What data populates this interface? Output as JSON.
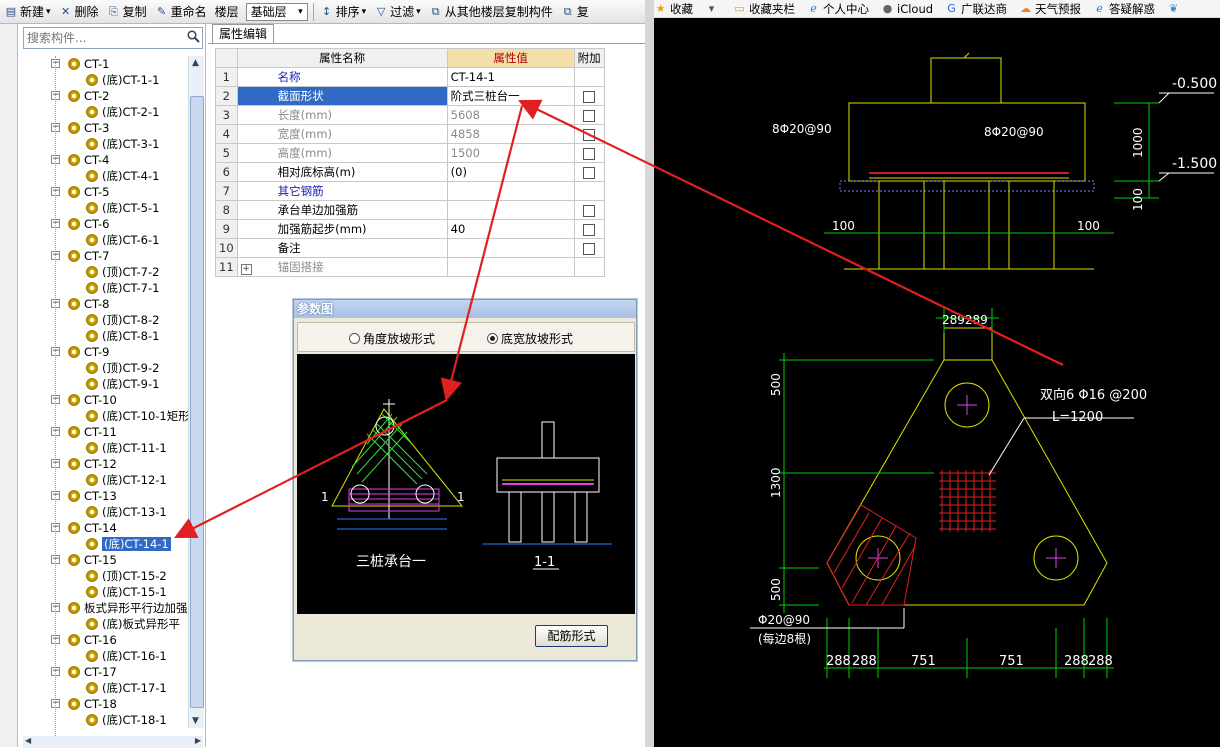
{
  "toolbar": {
    "items": [
      {
        "icon": "new-icon",
        "label": "新建",
        "dropdown": true
      },
      {
        "icon": "delete-icon",
        "label": "删除"
      },
      {
        "icon": "copy-icon",
        "label": "复制"
      },
      {
        "icon": "rename-icon",
        "label": "重命名"
      },
      {
        "icon": "",
        "label": "楼层"
      }
    ],
    "floor_value": "基础层",
    "items2": [
      {
        "icon": "sort-icon",
        "label": "排序",
        "dropdown": true
      },
      {
        "icon": "filter-icon",
        "label": "过滤",
        "dropdown": true
      },
      {
        "icon": "copy-floor-icon",
        "label": "从其他楼层复制构件"
      }
    ],
    "overflow_char": "复"
  },
  "search": {
    "placeholder": "搜索构件..."
  },
  "tree": [
    {
      "level": 0,
      "label": "CT-1"
    },
    {
      "level": 1,
      "label": "(底)CT-1-1"
    },
    {
      "level": 0,
      "label": "CT-2"
    },
    {
      "level": 1,
      "label": "(底)CT-2-1"
    },
    {
      "level": 0,
      "label": "CT-3"
    },
    {
      "level": 1,
      "label": "(底)CT-3-1"
    },
    {
      "level": 0,
      "label": "CT-4"
    },
    {
      "level": 1,
      "label": "(底)CT-4-1"
    },
    {
      "level": 0,
      "label": "CT-5"
    },
    {
      "level": 1,
      "label": "(底)CT-5-1"
    },
    {
      "level": 0,
      "label": "CT-6"
    },
    {
      "level": 1,
      "label": "(底)CT-6-1"
    },
    {
      "level": 0,
      "label": "CT-7"
    },
    {
      "level": 1,
      "label": "(顶)CT-7-2"
    },
    {
      "level": 1,
      "label": "(底)CT-7-1"
    },
    {
      "level": 0,
      "label": "CT-8"
    },
    {
      "level": 1,
      "label": "(顶)CT-8-2"
    },
    {
      "level": 1,
      "label": "(底)CT-8-1"
    },
    {
      "level": 0,
      "label": "CT-9"
    },
    {
      "level": 1,
      "label": "(顶)CT-9-2"
    },
    {
      "level": 1,
      "label": "(底)CT-9-1"
    },
    {
      "level": 0,
      "label": "CT-10"
    },
    {
      "level": 1,
      "label": "(底)CT-10-1矩形"
    },
    {
      "level": 0,
      "label": "CT-11"
    },
    {
      "level": 1,
      "label": "(底)CT-11-1"
    },
    {
      "level": 0,
      "label": "CT-12"
    },
    {
      "level": 1,
      "label": "(底)CT-12-1"
    },
    {
      "level": 0,
      "label": "CT-13"
    },
    {
      "level": 1,
      "label": "(底)CT-13-1"
    },
    {
      "level": 0,
      "label": "CT-14"
    },
    {
      "level": 1,
      "label": "(底)CT-14-1",
      "selected": true
    },
    {
      "level": 0,
      "label": "CT-15"
    },
    {
      "level": 1,
      "label": "(顶)CT-15-2"
    },
    {
      "level": 1,
      "label": "(底)CT-15-1"
    },
    {
      "level": 0,
      "label": "板式异形平行边加强"
    },
    {
      "level": 1,
      "label": "(底)板式异形平"
    },
    {
      "level": 0,
      "label": "CT-16"
    },
    {
      "level": 1,
      "label": "(底)CT-16-1"
    },
    {
      "level": 0,
      "label": "CT-17"
    },
    {
      "level": 1,
      "label": "(底)CT-17-1"
    },
    {
      "level": 0,
      "label": "CT-18"
    },
    {
      "level": 1,
      "label": "(底)CT-18-1"
    }
  ],
  "props": {
    "tab": "属性编辑",
    "headers": [
      "属性名称",
      "属性值",
      "附加"
    ],
    "rows": [
      {
        "n": "1",
        "name": "名称",
        "value": "CT-14-1",
        "style": "blue",
        "check": false
      },
      {
        "n": "2",
        "name": "截面形状",
        "value": "阶式三桩台一",
        "style": "sel",
        "check": true
      },
      {
        "n": "3",
        "name": "长度(mm)",
        "value": "5608",
        "style": "grey",
        "check": true
      },
      {
        "n": "4",
        "name": "宽度(mm)",
        "value": "4858",
        "style": "grey",
        "check": true
      },
      {
        "n": "5",
        "name": "高度(mm)",
        "value": "1500",
        "style": "grey",
        "check": true
      },
      {
        "n": "6",
        "name": "相对底标高(m)",
        "value": "(0)",
        "style": "",
        "check": true
      },
      {
        "n": "7",
        "name": "其它钢筋",
        "value": "",
        "style": "blue",
        "check": false
      },
      {
        "n": "8",
        "name": "承台单边加强筋",
        "value": "",
        "style": "",
        "check": true
      },
      {
        "n": "9",
        "name": "加强筋起步(mm)",
        "value": "40",
        "style": "",
        "check": true
      },
      {
        "n": "10",
        "name": "备注",
        "value": "",
        "style": "",
        "check": true
      },
      {
        "n": "11",
        "name": "锚固搭接",
        "value": "",
        "style": "grey",
        "check": false,
        "expand": true
      }
    ]
  },
  "dialog": {
    "title": "参数图",
    "radio1": "角度放坡形式",
    "radio2": "底宽放坡形式",
    "fig_left": "三桩承台一",
    "fig_right": "1-1",
    "sec_mark": "1",
    "button": "配筋形式"
  },
  "bookmarks": [
    {
      "icon": "star-icon",
      "label": "收藏",
      "color": "#f0a000"
    },
    {
      "icon": "chevron-down-icon",
      "label": "",
      "color": "#555"
    },
    {
      "icon": "folder-icon",
      "label": "收藏夹栏",
      "color": "#d8a030"
    },
    {
      "icon": "ie-icon",
      "label": "个人中心",
      "color": "#2a7ad6"
    },
    {
      "icon": "apple-icon",
      "label": "iCloud",
      "color": "#666"
    },
    {
      "icon": "g-icon",
      "label": "广联达商",
      "color": "#1a6ad0"
    },
    {
      "icon": "weather-icon",
      "label": "天气预报",
      "color": "#e08a20"
    },
    {
      "icon": "ie-icon",
      "label": "答疑解惑",
      "color": "#2a7ad6"
    },
    {
      "icon": "bird-icon",
      "label": "",
      "color": "#2a90d6"
    }
  ],
  "cad": {
    "elev1": "-0.500",
    "elev2": "-1.500",
    "dim_h1": "1000",
    "dim_h2": "100",
    "rebar1": "8Φ20@90",
    "rebar2": "8Φ20@90",
    "dim_100a": "100",
    "dim_100b": "100",
    "dim_top": "289289",
    "mesh1": "双向6 Φ16 @200",
    "mesh2": "L=1200",
    "dim_v1": "500",
    "dim_v2": "1300",
    "dim_v3": "500",
    "rebar3": "Φ20@90",
    "rebar3b": "(每边8根)",
    "bot_dims": [
      "288",
      "288",
      "751",
      "751",
      "288",
      "288"
    ]
  },
  "colors": {
    "arrow": "#e02020",
    "cad_line": "#e0e000",
    "cad_dim": "#00d000",
    "cad_text": "#ffffff"
  }
}
